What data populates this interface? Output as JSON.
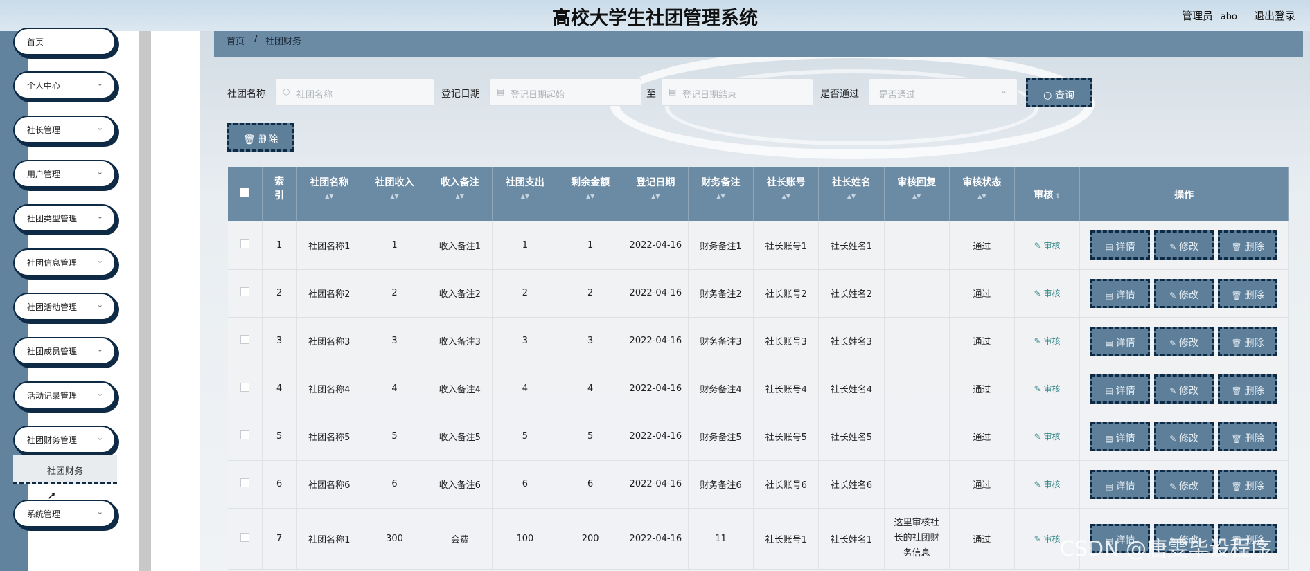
{
  "header": {
    "title": "高校大学生社团管理系统",
    "role": "管理员",
    "username": "abo",
    "logout": "退出登录"
  },
  "sidebar": {
    "items": [
      {
        "label": "首页",
        "has_chevron": false
      },
      {
        "label": "个人中心",
        "has_chevron": true
      },
      {
        "label": "社长管理",
        "has_chevron": true
      },
      {
        "label": "用户管理",
        "has_chevron": true
      },
      {
        "label": "社团类型管理",
        "has_chevron": true
      },
      {
        "label": "社团信息管理",
        "has_chevron": true
      },
      {
        "label": "社团活动管理",
        "has_chevron": true
      },
      {
        "label": "社团成员管理",
        "has_chevron": true
      },
      {
        "label": "活动记录管理",
        "has_chevron": true
      },
      {
        "label": "社团财务管理",
        "has_chevron": true
      },
      {
        "label": "系统管理",
        "has_chevron": true
      }
    ],
    "active_sub": "社团财务"
  },
  "breadcrumb": {
    "home": "首页",
    "sep": "/",
    "current": "社团财务"
  },
  "filters": {
    "club_name_label": "社团名称",
    "club_name_placeholder": "社团名称",
    "date_label": "登记日期",
    "date_start_placeholder": "登记日期起始",
    "to": "至",
    "date_end_placeholder": "登记日期结束",
    "pass_label": "是否通过",
    "pass_placeholder": "是否通过",
    "search_button": "查询"
  },
  "toolbar": {
    "delete_button": "删除"
  },
  "table": {
    "headers": [
      "索引",
      "社团名称",
      "社团收入",
      "收入备注",
      "社团支出",
      "剩余金额",
      "登记日期",
      "财务备注",
      "社长账号",
      "社长姓名",
      "审核回复",
      "审核状态",
      "审核",
      "操作"
    ],
    "rows": [
      {
        "index": "1",
        "name": "社团名称1",
        "income": "1",
        "income_note": "收入备注1",
        "expense": "1",
        "balance": "1",
        "date": "2022-04-16",
        "fin_note": "财务备注1",
        "account": "社长账号1",
        "president": "社长姓名1",
        "reply": "",
        "status": "通过"
      },
      {
        "index": "2",
        "name": "社团名称2",
        "income": "2",
        "income_note": "收入备注2",
        "expense": "2",
        "balance": "2",
        "date": "2022-04-16",
        "fin_note": "财务备注2",
        "account": "社长账号2",
        "president": "社长姓名2",
        "reply": "",
        "status": "通过"
      },
      {
        "index": "3",
        "name": "社团名称3",
        "income": "3",
        "income_note": "收入备注3",
        "expense": "3",
        "balance": "3",
        "date": "2022-04-16",
        "fin_note": "财务备注3",
        "account": "社长账号3",
        "president": "社长姓名3",
        "reply": "",
        "status": "通过"
      },
      {
        "index": "4",
        "name": "社团名称4",
        "income": "4",
        "income_note": "收入备注4",
        "expense": "4",
        "balance": "4",
        "date": "2022-04-16",
        "fin_note": "财务备注4",
        "account": "社长账号4",
        "president": "社长姓名4",
        "reply": "",
        "status": "通过"
      },
      {
        "index": "5",
        "name": "社团名称5",
        "income": "5",
        "income_note": "收入备注5",
        "expense": "5",
        "balance": "5",
        "date": "2022-04-16",
        "fin_note": "财务备注5",
        "account": "社长账号5",
        "president": "社长姓名5",
        "reply": "",
        "status": "通过"
      },
      {
        "index": "6",
        "name": "社团名称6",
        "income": "6",
        "income_note": "收入备注6",
        "expense": "6",
        "balance": "6",
        "date": "2022-04-16",
        "fin_note": "财务备注6",
        "account": "社长账号6",
        "president": "社长姓名6",
        "reply": "",
        "status": "通过"
      },
      {
        "index": "7",
        "name": "社团名称1",
        "income": "300",
        "income_note": "会费",
        "expense": "100",
        "balance": "200",
        "date": "2022-04-16",
        "fin_note": "11",
        "account": "社长账号1",
        "president": "社长姓名1",
        "reply": "这里审核社长的社团财务信息",
        "status": "通过"
      }
    ],
    "audit_link": "审核",
    "actions": {
      "detail": "详情",
      "edit": "修改",
      "delete": "删除"
    }
  },
  "watermark": "CSDN @唐雯毕设程序"
}
